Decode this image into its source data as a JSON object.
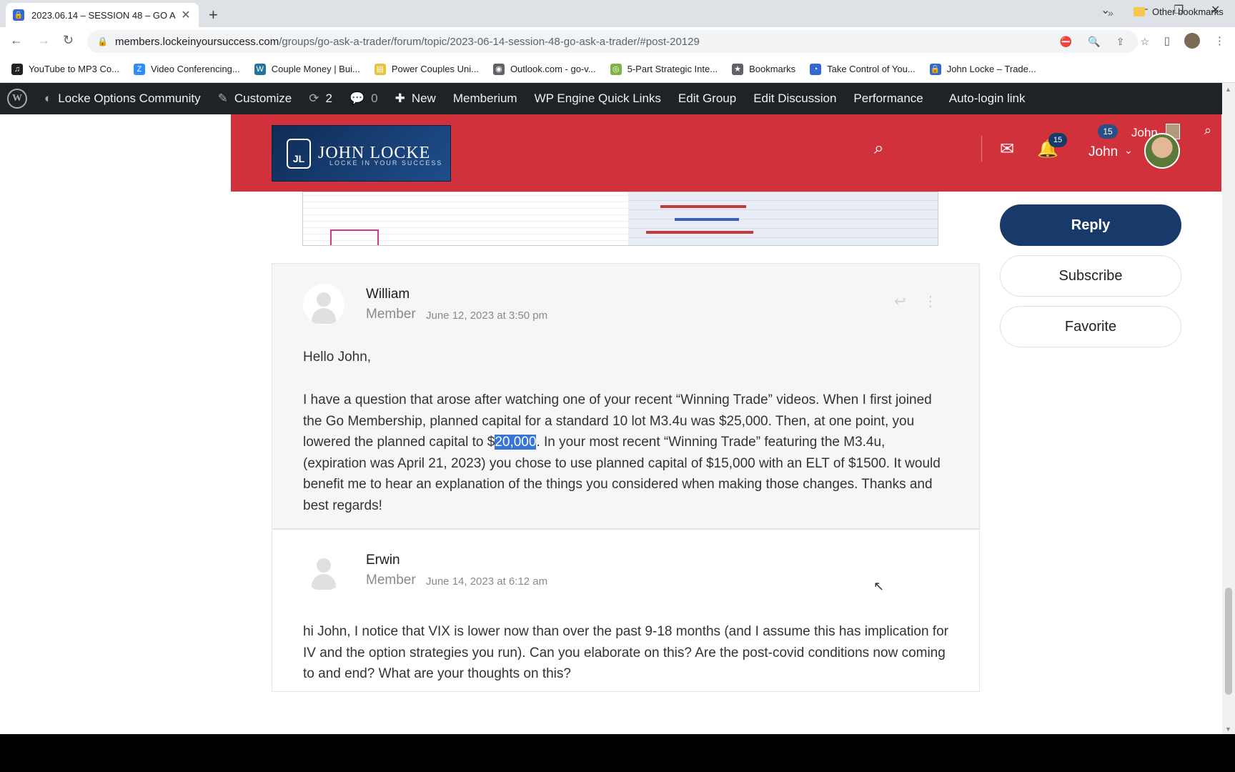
{
  "browser": {
    "tab_title": "2023.06.14 – SESSION 48 – GO A",
    "url_host": "members.lockeinyoursuccess.com",
    "url_path": "/groups/go-ask-a-trader/forum/topic/2023-06-14-session-48-go-ask-a-trader/#post-20129"
  },
  "bookmarks": [
    {
      "label": "YouTube to MP3 Co...",
      "icon": "music-note-icon",
      "color": "#222222"
    },
    {
      "label": "Video Conferencing...",
      "icon": "zoom-icon",
      "color": "#2d8cff"
    },
    {
      "label": "Couple Money | Bui...",
      "icon": "wordpress-icon",
      "color": "#21759b"
    },
    {
      "label": "Power Couples Uni...",
      "icon": "page-icon",
      "color": "#e8c33a"
    },
    {
      "label": "Outlook.com - go-v...",
      "icon": "globe-icon",
      "color": "#5f6368"
    },
    {
      "label": "5-Part Strategic Inte...",
      "icon": "target-icon",
      "color": "#7cb342"
    },
    {
      "label": "Bookmarks",
      "icon": "star-icon",
      "color": "#5f6368"
    },
    {
      "label": "Take Control of You...",
      "icon": "swirl-icon",
      "color": "#3367d6"
    },
    {
      "label": "John Locke – Trade...",
      "icon": "lock-icon",
      "color": "#3367d6"
    }
  ],
  "bookmarks_other": "Other bookmarks",
  "adminbar": {
    "site": "Locke Options Community",
    "customize": "Customize",
    "updates": "2",
    "comments": "0",
    "new": "New",
    "items": [
      "Memberium",
      "WP Engine Quick Links",
      "Edit Group",
      "Edit Discussion",
      "Performance",
      "Auto-login link"
    ]
  },
  "header": {
    "logo_name": "JOHN LOCKE",
    "logo_tagline": "LOCKE IN YOUR SUCCESS",
    "logo_initials": "JL",
    "notif_count": "15",
    "user_name": "John",
    "badge_count": "15",
    "user_name_small": "John",
    "brand_color": "#d1313a"
  },
  "posts": [
    {
      "author": "William",
      "role": "Member",
      "date": "June 12, 2023 at 3:50 pm",
      "greeting": "Hello John,",
      "text_before": "I have a question that arose after watching one of your recent “Winning Trade” videos. When I first joined the Go Membership, planned capital for a standard 10 lot M3.4u was $25,000. Then, at one point, you lowered the planned capital to $",
      "text_highlight": "20,000",
      "text_after": ". In your most recent “Winning Trade” featuring the M3.4u, (expiration was April 21, 2023) you chose to use planned capital of $15,000 with an ELT of $1500. It would benefit me to hear an explanation of the things you considered when making those changes. Thanks and best regards!"
    },
    {
      "author": "Erwin",
      "role": "Member",
      "date": "June 14, 2023 at 6:12 am",
      "text": "hi John, I notice that VIX is lower now than over the past 9-18 months (and I assume this has implication for IV and the option strategies you run). Can you elaborate on this? Are the post-covid conditions now coming to and end? What are your thoughts on this?"
    }
  ],
  "sidebar": {
    "reply": "Reply",
    "subscribe": "Subscribe",
    "favorite": "Favorite"
  }
}
